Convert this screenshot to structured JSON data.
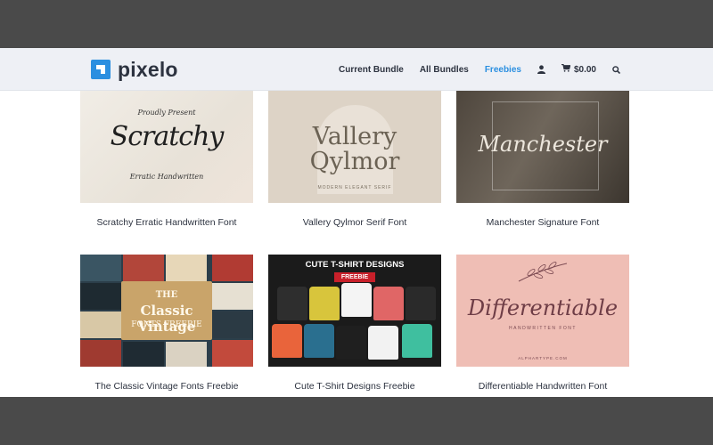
{
  "header": {
    "logo_text": "pixelo",
    "nav": [
      {
        "label": "Current Bundle",
        "active": false
      },
      {
        "label": "All Bundles",
        "active": false
      },
      {
        "label": "Freebies",
        "active": true
      }
    ],
    "cart_total": "$0.00",
    "icons": {
      "account": "user-icon",
      "cart": "cart-icon",
      "search": "search-icon"
    }
  },
  "products": [
    {
      "caption": "Scratchy Erratic Handwritten Font",
      "art": {
        "top": "Proudly Present",
        "title": "Scratchy",
        "bottom": "Erratic Handwritten"
      }
    },
    {
      "caption": "Vallery Qylmor Serif Font",
      "art": {
        "line1": "Vallery",
        "line2": "Qylmor",
        "sub": "MODERN ELEGANT SERIF"
      }
    },
    {
      "caption": "Manchester Signature Font",
      "art": {
        "title": "Manchester"
      }
    },
    {
      "caption": "The Classic Vintage Fonts Freebie",
      "art": {
        "a": "THE",
        "b": "Classic Vintage",
        "c": "FONTS FREEBIE"
      }
    },
    {
      "caption": "Cute T-Shirt Designs Freebie",
      "art": {
        "title": "CUTE T-SHIRT DESIGNS",
        "badge": "FREEBIE"
      }
    },
    {
      "caption": "Differentiable Handwritten Font",
      "art": {
        "title": "Differentiable",
        "sub": "HANDWRITTEN FONT",
        "foot": "ALPHARTYPE.COM"
      }
    }
  ],
  "colors": {
    "accent": "#2b8fe0",
    "text": "#2d3340",
    "header_bg": "#eef0f5"
  }
}
